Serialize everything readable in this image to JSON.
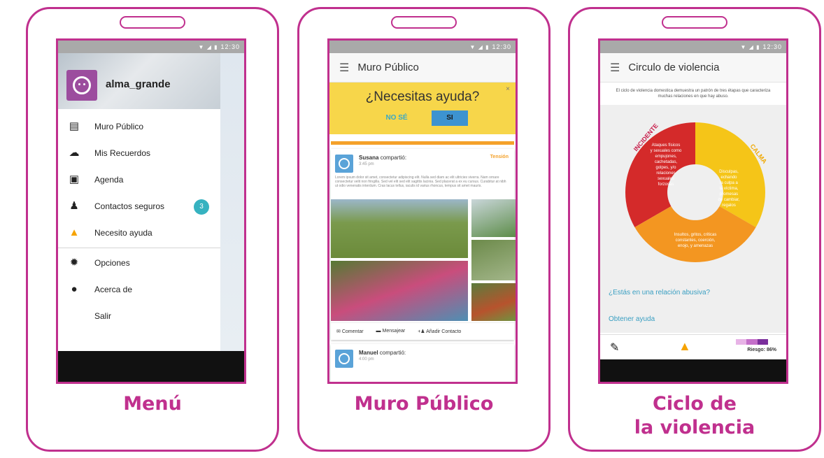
{
  "statusbar": {
    "time": "12:30",
    "icons": "▼ ◢ ▮"
  },
  "menu_phone": {
    "caption": "Menú",
    "username": "alma_grande",
    "items": [
      {
        "label": "Muro Público",
        "icon": "feed-icon"
      },
      {
        "label": "Mis Recuerdos",
        "icon": "cloud-icon"
      },
      {
        "label": "Agenda",
        "icon": "calendar-icon"
      },
      {
        "label": "Contactos seguros",
        "icon": "people-icon",
        "badge": "3"
      },
      {
        "label": "Necesito ayuda",
        "icon": "warning-icon"
      },
      {
        "label": "Opciones",
        "icon": "gear-icon"
      },
      {
        "label": "Acerca de",
        "icon": "info-icon"
      },
      {
        "label": "Salir",
        "icon": ""
      }
    ]
  },
  "muro_phone": {
    "caption": "Muro Público",
    "appbar_title": "Muro Público",
    "help_banner": {
      "title": "¿Necesitas ayuda?",
      "no_label": "NO SÉ",
      "si_label": "SI",
      "close": "×"
    },
    "post1": {
      "author": "Susana",
      "action": " compartió:",
      "time": "3:45 pm",
      "tag": "Tensión",
      "text": "Lorem ipsum dolor sit amet, consectetur adipiscing elit. Nulla sed diam ac elit ultricies viverra. Nam ornare consectetur velit non fringilla. Sed vel elit sed elit sagittis lacinia. Sed placerat a ex eu cursus. Curabitur at nibh ut odio venenatis interdum. Cras lacus tellus, iaculis id varius rhoncus, tempus sit amet mauris.",
      "actions": {
        "comment": "Comentar",
        "message": "Mensajear",
        "add_contact": "Añadir Contacto"
      }
    },
    "post2": {
      "author": "Manuel",
      "action": " compartió:",
      "time": "4:00 pm"
    }
  },
  "ciclo_phone": {
    "caption_line1": "Ciclo de",
    "caption_line2": "la violencia",
    "appbar_title": "Circulo de violencia",
    "intro": "El ciclo de violencia domestica demuestra un patrón de tres étapas que caracteriza muchas relaciones en que hay abuso.",
    "segments": {
      "incidente_label": "INCIDENTE",
      "calma_label": "CALMA",
      "incidente_text": [
        "Ataques físicos",
        "y sexuales como",
        "empujones,",
        "cachetadas,",
        "golpes, y/o",
        "relaciones",
        "sexuales",
        "forzosas"
      ],
      "calma_text": [
        "Disculpas,",
        "echando",
        "la culpa a",
        "la víctima,",
        "promesas",
        "de cambiar,",
        "regalos"
      ],
      "tension_text": [
        "Insultos, gritos, criticas",
        "constantes, coerción,",
        "enojo, y amenazas"
      ]
    },
    "question_link": "¿Estás en una relación abusiva?",
    "help_link": "Obtener ayuda",
    "risk_label": "Riesgo: 86%",
    "risk_percent": 86
  },
  "colors": {
    "accent": "#c0308e",
    "incidente": "#d42a2a",
    "calma": "#f5c518",
    "tension": "#f39621",
    "risk_light": "#e7b3e6",
    "risk_dark": "#7b2f9c"
  }
}
